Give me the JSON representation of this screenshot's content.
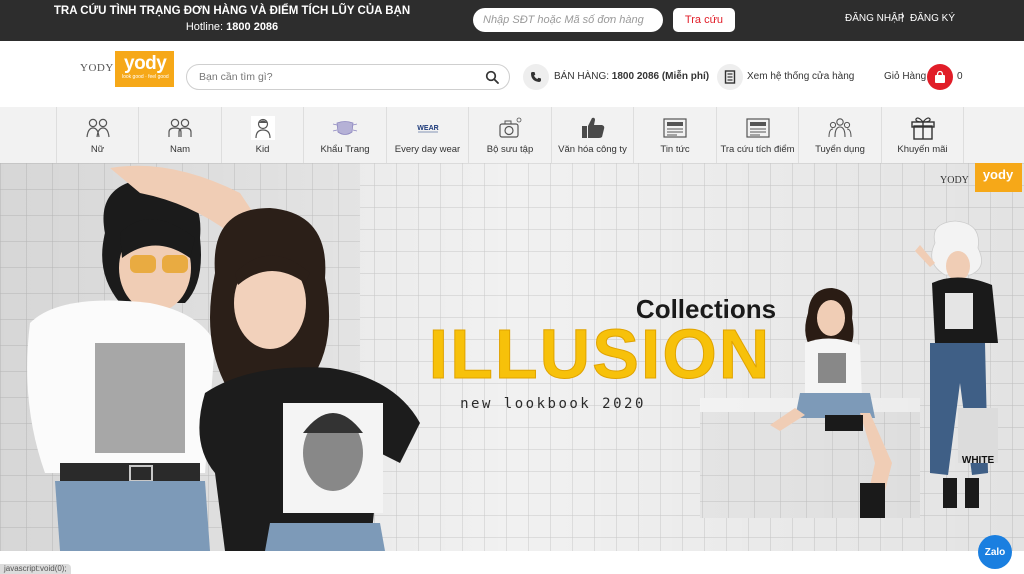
{
  "topbar": {
    "title": "TRA CỨU TÌNH TRẠNG ĐƠN HÀNG VÀ ĐIỂM TÍCH LŨY CỦA BẠN",
    "hotline_label": "Hotline:",
    "hotline_number": "1800 2086",
    "order_placeholder": "Nhập SĐT hoặc Mã số đơn hàng",
    "lookup_button": "Tra cứu",
    "login": "ĐĂNG NHẬP",
    "separator": "|",
    "register": "ĐĂNG KÝ"
  },
  "header": {
    "logo_text": "YODY",
    "logo_mark": "yody",
    "logo_tagline": "look good · feel good",
    "search_placeholder": "Bạn cần tìm gì?",
    "sales_label": "BÁN HÀNG:",
    "sales_number": "1800 2086 (Miễn phí)",
    "stores_label": "Xem hệ thống cửa hàng",
    "cart_label": "Giỏ Hàng",
    "cart_count": "0"
  },
  "nav": {
    "items": [
      {
        "label": "Nữ",
        "icon": "women-icon"
      },
      {
        "label": "Nam",
        "icon": "men-icon"
      },
      {
        "label": "Kid",
        "icon": "kid-icon"
      },
      {
        "label": "Khẩu Trang",
        "icon": "mask-icon"
      },
      {
        "label": "Every day wear",
        "icon": "wear-logo-icon"
      },
      {
        "label": "Bộ sưu tập",
        "icon": "camera-icon"
      },
      {
        "label": "Văn hóa công ty",
        "icon": "thumbs-up-icon"
      },
      {
        "label": "Tin tức",
        "icon": "news-icon"
      },
      {
        "label": "Tra cứu tích điểm",
        "icon": "news-lookup-icon"
      },
      {
        "label": "Tuyển dụng",
        "icon": "team-icon"
      },
      {
        "label": "Khuyến mãi",
        "icon": "gift-icon"
      }
    ]
  },
  "banner": {
    "collections": "Collections",
    "title": "ILLUSION",
    "subtitle": "new lookbook 2020",
    "corner_logo_text": "YODY",
    "corner_logo_mark": "yody",
    "bag_text": "WHITE"
  },
  "status": {
    "url": "javascript:void(0);"
  },
  "zalo": {
    "label": "Zalo"
  },
  "colors": {
    "topbar": "#2d2d2d",
    "accent_red": "#e11d28",
    "brand_yellow": "#f6a818",
    "banner_headline": "#f7c10a"
  }
}
